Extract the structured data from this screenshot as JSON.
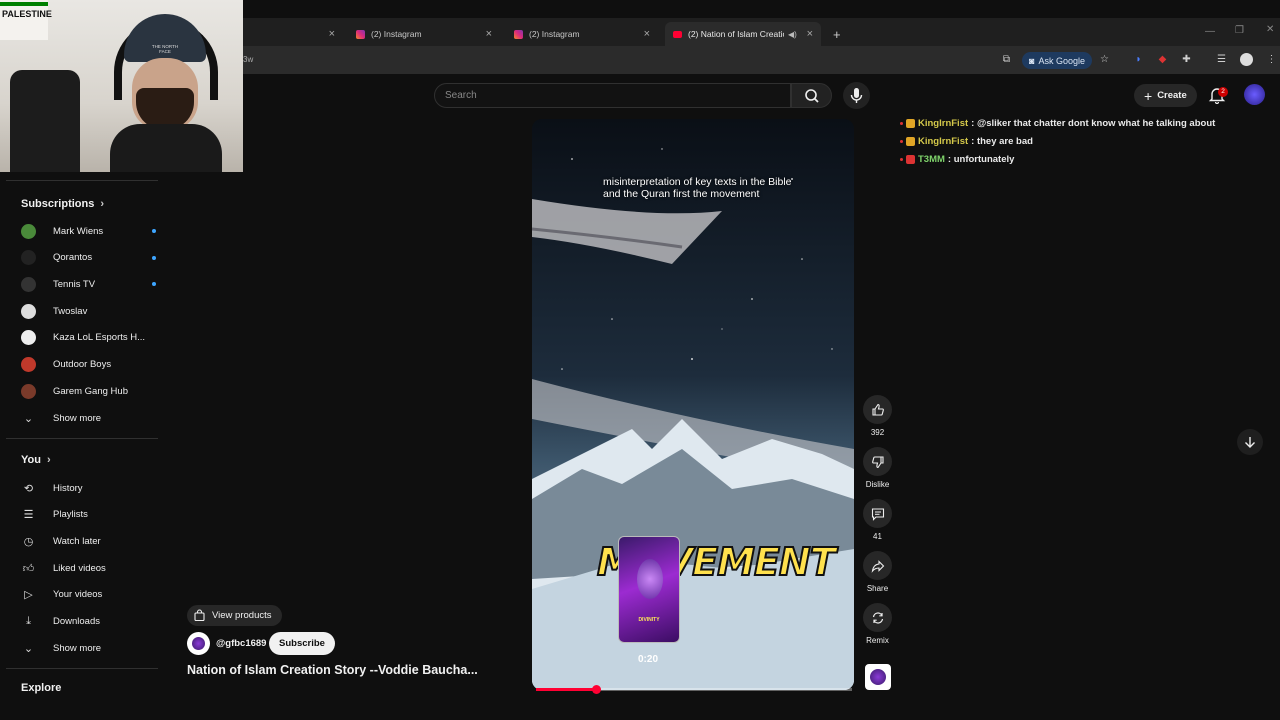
{
  "browser": {
    "tabs": [
      {
        "label": "(2) Instagram",
        "type": "instagram",
        "active": false
      },
      {
        "label": "(2) Instagram",
        "type": "instagram",
        "active": false
      },
      {
        "label": "(2) Nation of Islam Creation",
        "type": "youtube",
        "active": true
      }
    ],
    "url_fragment": "3w",
    "ask_google_label": "Ask Google"
  },
  "webcam": {
    "sign_text": "PALESTINE",
    "beanie_text": "THE NORTH FACE"
  },
  "header": {
    "search_placeholder": "Search",
    "create_label": "Create",
    "notification_count": "2"
  },
  "sidebar": {
    "subscriptions_title": "Subscriptions",
    "subscriptions": [
      {
        "name": "Mark Wiens",
        "color": "#4a8a3a",
        "new": true
      },
      {
        "name": "Qorantos",
        "color": "#222222",
        "new": true
      },
      {
        "name": "Tennis TV",
        "color": "#333333",
        "new": true
      },
      {
        "name": "Twoslav",
        "color": "#dddddd",
        "new": false
      },
      {
        "name": "Kaza LoL Esports H...",
        "color": "#eeeeee",
        "new": false
      },
      {
        "name": "Outdoor Boys",
        "color": "#c0392b",
        "new": false
      },
      {
        "name": "Garem Gang Hub",
        "color": "#7a3a2a",
        "new": false
      }
    ],
    "show_more_1": "Show more",
    "you_title": "You",
    "you_items": [
      {
        "label": "History",
        "icon": "history-icon"
      },
      {
        "label": "Playlists",
        "icon": "playlists-icon"
      },
      {
        "label": "Watch later",
        "icon": "watch-later-icon"
      },
      {
        "label": "Liked videos",
        "icon": "liked-videos-icon"
      },
      {
        "label": "Your videos",
        "icon": "your-videos-icon"
      },
      {
        "label": "Downloads",
        "icon": "downloads-icon"
      }
    ],
    "show_more_2": "Show more",
    "explore_title": "Explore"
  },
  "chat": [
    {
      "user": "KingIrnFist",
      "message": ": @sliker that chatter dont know what he talking about",
      "color": "#d4c84a"
    },
    {
      "user": "KingIrnFist",
      "message": ": they are bad",
      "color": "#d4c84a"
    },
    {
      "user": "T3MM",
      "message": ": unfortunately",
      "color": "#7fd36b"
    }
  ],
  "video": {
    "caption": "misinterpretation of key texts in the Bible and the Quran first the movement",
    "overlay_word": "MOVEMENT",
    "thumb_label": "DIVINITY",
    "time": "0:20",
    "progress_fraction": 0.19,
    "view_products": "View products",
    "channel": "@gfbc1689",
    "subscribe_label": "Subscribe",
    "title": "Nation of Islam Creation Story --Voddie Baucha..."
  },
  "actions": {
    "likes": "392",
    "dislike_label": "Dislike",
    "comments": "41",
    "share_label": "Share",
    "remix_label": "Remix"
  }
}
